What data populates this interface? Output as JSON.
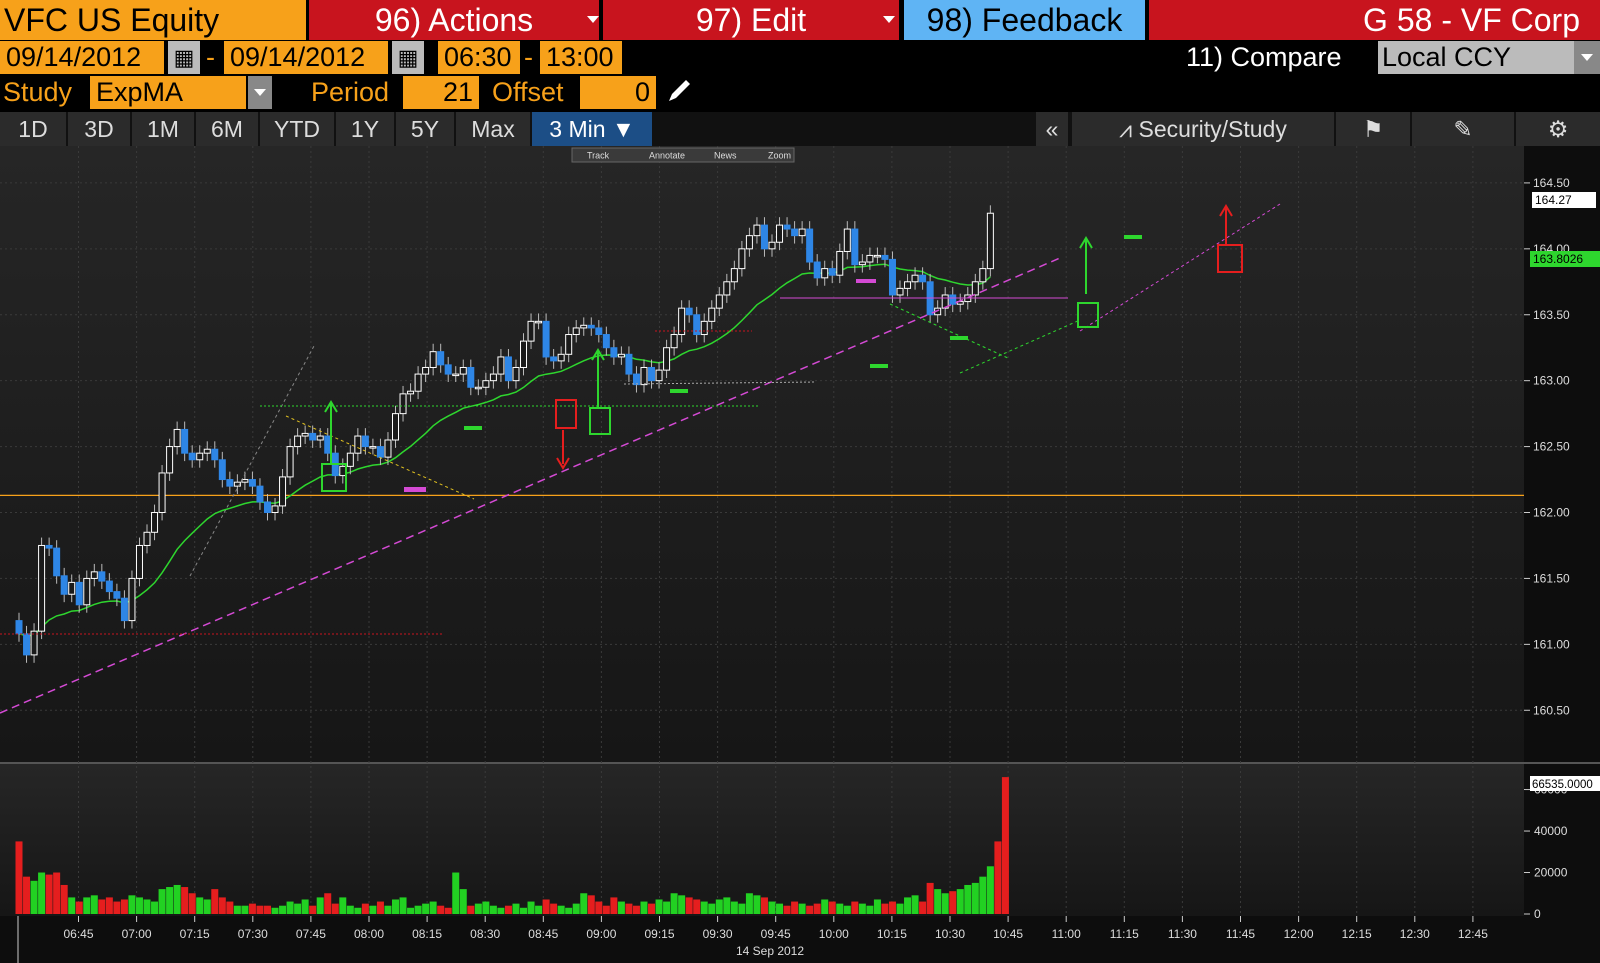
{
  "header": {
    "ticker": "VFC US Equity",
    "actions": "96) Actions",
    "edit": "97) Edit",
    "feedback": "98) Feedback",
    "title": "G 58 - VF Corp"
  },
  "controls": {
    "start_date": "09/14/2012",
    "dash1": "-",
    "end_date": "09/14/2012",
    "start_time": "06:30",
    "dash2": "-",
    "end_time": "13:00",
    "compare": "11) Compare",
    "currency": "Local CCY",
    "study_label": "Study",
    "study_value": "ExpMA",
    "period_label": "Period",
    "period_value": "21",
    "offset_label": "Offset",
    "offset_value": "0"
  },
  "tabs": [
    "1D",
    "3D",
    "1M",
    "6M",
    "YTD",
    "1Y",
    "5Y",
    "Max"
  ],
  "interval": "3 Min",
  "toolbar": {
    "collapse": "«",
    "security_study": "Security/Study"
  },
  "chart_tools": [
    "Track",
    "Annotate",
    "News",
    "Zoom"
  ],
  "colors": {
    "up_candle": "#ffffff",
    "down_candle": "#2e86e6",
    "ema": "#2ed62e",
    "vol_up": "#22d122",
    "vol_down": "#e51e1e",
    "accent": "#f7a11a"
  },
  "chart_data": [
    {
      "type": "candlestick",
      "x_ticks": [
        "06:45",
        "07:00",
        "07:15",
        "07:30",
        "07:45",
        "08:00",
        "08:15",
        "08:30",
        "08:45",
        "09:00",
        "09:15",
        "09:30",
        "09:45",
        "10:00",
        "10:15",
        "10:30",
        "10:45",
        "11:00",
        "11:15",
        "11:30",
        "11:45",
        "12:00",
        "12:15",
        "12:30",
        "12:45"
      ],
      "x_date_label": "14 Sep 2012",
      "y_ticks": [
        164.5,
        164.0,
        163.5,
        163.0,
        162.5,
        162.0,
        161.5,
        161.0,
        160.5
      ],
      "ylim": [
        160.1,
        164.78
      ],
      "last_price": "164.27",
      "ema_label": "163.8026",
      "reference_line": 162.13,
      "close": [
        161.08,
        160.92,
        161.1,
        161.75,
        161.73,
        161.52,
        161.38,
        161.47,
        161.3,
        161.5,
        161.55,
        161.48,
        161.4,
        161.35,
        161.18,
        161.5,
        161.75,
        161.85,
        162.0,
        162.3,
        162.5,
        162.63,
        162.45,
        162.4,
        162.45,
        162.48,
        162.4,
        162.25,
        162.2,
        162.23,
        162.25,
        162.2,
        162.08,
        162.0,
        162.05,
        162.27,
        162.5,
        162.58,
        162.6,
        162.55,
        162.58,
        162.45,
        162.28,
        162.35,
        162.45,
        162.58,
        162.5,
        162.5,
        162.42,
        162.55,
        162.75,
        162.9,
        162.92,
        163.05,
        163.1,
        163.22,
        163.12,
        163.05,
        163.05,
        163.1,
        162.95,
        162.95,
        163.0,
        163.05,
        163.18,
        163.0,
        163.1,
        163.3,
        163.45,
        163.45,
        163.18,
        163.15,
        163.2,
        163.35,
        163.4,
        163.42,
        163.4,
        163.35,
        163.25,
        163.18,
        163.2,
        163.05,
        162.97,
        163.1,
        163.0,
        163.08,
        163.25,
        163.35,
        163.55,
        163.5,
        163.35,
        163.45,
        163.55,
        163.65,
        163.75,
        163.85,
        164.0,
        164.1,
        164.18,
        164.0,
        164.05,
        164.18,
        164.15,
        164.1,
        164.15,
        163.9,
        163.78,
        163.85,
        163.8,
        163.98,
        164.15,
        163.88,
        163.9,
        163.95,
        163.95,
        163.92,
        163.65,
        163.7,
        163.75,
        163.8,
        163.75,
        163.5,
        163.55,
        163.65,
        163.58,
        163.6,
        163.65,
        163.75,
        163.85,
        164.27
      ],
      "volume_ylim": [
        0,
        66535
      ],
      "volume_ticks": [
        60000,
        40000,
        20000,
        0
      ],
      "volume_last": "66535.0000",
      "volume": [
        35000,
        18000,
        16000,
        20000,
        19000,
        20000,
        14000,
        8000,
        6000,
        8000,
        9000,
        7000,
        8000,
        6000,
        7000,
        9000,
        8000,
        7000,
        6000,
        12000,
        13000,
        14000,
        13000,
        10000,
        8000,
        7000,
        12000,
        8000,
        6000,
        4000,
        4000,
        5000,
        4000,
        4000,
        3000,
        4000,
        6000,
        5000,
        7000,
        4000,
        8000,
        10000,
        5000,
        8000,
        4000,
        3000,
        5000,
        4000,
        6000,
        4000,
        7000,
        8000,
        3000,
        4000,
        5000,
        6000,
        4000,
        3000,
        20000,
        12000,
        4000,
        5000,
        6000,
        4000,
        3000,
        4000,
        5000,
        3000,
        6000,
        4000,
        7000,
        5000,
        4000,
        3000,
        5000,
        10000,
        9000,
        6000,
        4000,
        8000,
        6000,
        5000,
        4000,
        6000,
        5000,
        7000,
        6000,
        10000,
        9000,
        8000,
        7000,
        6000,
        5000,
        7000,
        8000,
        6000,
        5000,
        10000,
        9000,
        8000,
        6000,
        5000,
        4000,
        6000,
        5000,
        4000,
        5000,
        7000,
        6000,
        5000,
        4000,
        6000,
        5000,
        4000,
        7000,
        5000,
        6000,
        5000,
        8000,
        9000,
        6000,
        15000,
        12000,
        10000,
        11000,
        12000,
        14000,
        15000,
        18000,
        23000,
        35000,
        66000
      ]
    }
  ]
}
